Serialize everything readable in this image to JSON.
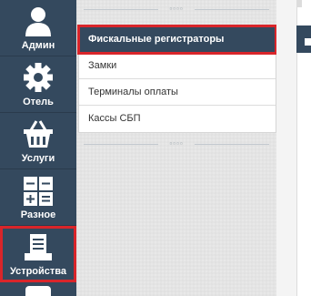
{
  "sidebar": {
    "items": [
      {
        "label": "Админ",
        "icon": "user-icon"
      },
      {
        "label": "Отель",
        "icon": "gear-icon"
      },
      {
        "label": "Услуги",
        "icon": "basket-icon"
      },
      {
        "label": "Разное",
        "icon": "calculator-icon"
      },
      {
        "label": "Устройства",
        "icon": "printer-icon"
      }
    ]
  },
  "submenu": {
    "items": [
      {
        "label": "Фискальные регистраторы",
        "active": true
      },
      {
        "label": "Замки",
        "active": false
      },
      {
        "label": "Терминалы оплаты",
        "active": false
      },
      {
        "label": "Кассы СБП",
        "active": false
      }
    ]
  },
  "colors": {
    "sidebar_bg": "#34495e",
    "highlight": "#d9252a"
  }
}
